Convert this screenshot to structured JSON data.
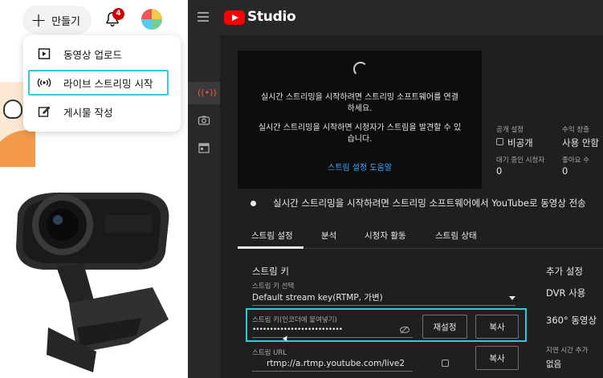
{
  "left": {
    "create_label": "만들기",
    "notification_count": "4",
    "menu": {
      "upload_label": "동영상 업로드",
      "live_label": "라이브 스트리밍 시작",
      "post_label": "게시물 작성"
    }
  },
  "studio": {
    "logo_text": "Studio",
    "preview": {
      "line1": "실시간 스트리밍을 시작하려면 스트리밍 소프트웨어를 연결",
      "line2": "하세요.",
      "line3": "실시간 스트리밍을 시작하면 시청자가 스트림을 발견할 수 있",
      "line4": "습니다.",
      "help_link": "스트림 설정 도움말"
    },
    "info": {
      "visibility_label": "공개 설정",
      "visibility_value": "비공개",
      "monetization_label": "수익 창출",
      "monetization_value": "사용 안함",
      "viewers_label": "대기 중인 시청자",
      "viewers_value": "0",
      "likes_label": "좋아요 수",
      "likes_value": "0"
    },
    "status_text": "실시간 스트리밍을 시작하려면 스트리밍 소프트웨어에서 YouTube로 동영상 전송",
    "tabs": [
      "스트림 설정",
      "분석",
      "시청자 활동",
      "스트림 상태"
    ],
    "stream_key_section": {
      "title": "스트림 키",
      "select_label": "스트림 키 선택",
      "select_value": "Default stream key(RTMP, 가변)",
      "key_label": "스트림 키(인코더에 붙여넣기)",
      "key_value": "••••••••••••••••••••••••••",
      "reset_label": "재설정",
      "copy_label": "복사",
      "url_label": "스트림 URL",
      "url_value": "rtmp://a.rtmp.youtube.com/live2",
      "copy_url_label": "복사"
    },
    "additional_settings": {
      "title": "추가 설정",
      "dvr_label": "DVR 사용",
      "video360_label": "360° 동영상",
      "latency_label": "지연 시간 추가",
      "latency_value": "없음"
    }
  },
  "colors": {
    "highlight": "#36c9d6",
    "studio_bg": "#1f1f1f",
    "link": "#3ea6ff",
    "brand_red": "#ff0000"
  }
}
